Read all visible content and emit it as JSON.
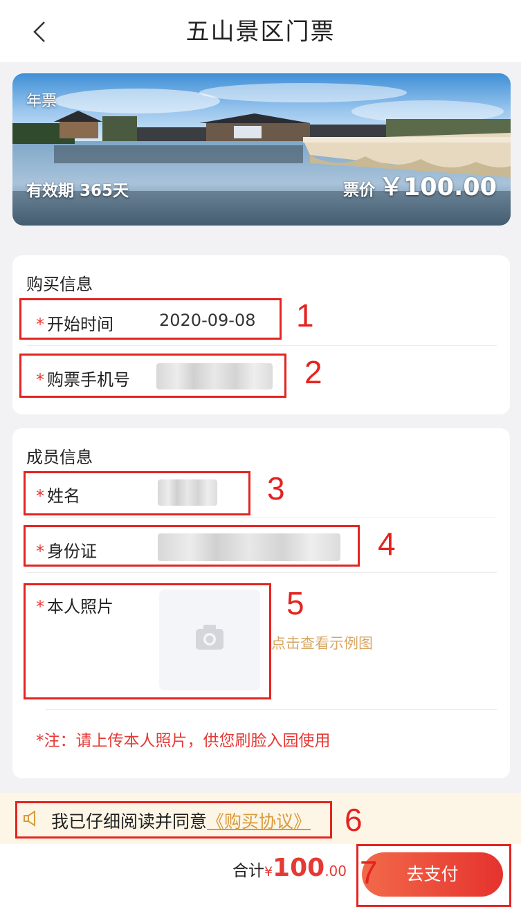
{
  "header": {
    "title": "五山景区门票"
  },
  "ticket": {
    "type_tag": "年票",
    "validity": "有效期 365天",
    "price_label": "票价",
    "price": "￥100.00"
  },
  "purchase_info": {
    "title": "购买信息",
    "start_time_label": "开始时间",
    "start_time_value": "2020-09-08",
    "phone_label": "购票手机号"
  },
  "member_info": {
    "title": "成员信息",
    "name_label": "姓名",
    "id_label": "身份证",
    "photo_label": "本人照片",
    "example_link": "点击查看示例图",
    "note": "*注：请上传本人照片，供您刷脸入园使用"
  },
  "agreement": {
    "text": "我已仔细阅读并同意",
    "link": "《购买协议》"
  },
  "footer": {
    "total_label": "合计",
    "currency": "¥",
    "total_int": "100",
    "total_dec": ".00",
    "pay_button": "去支付"
  },
  "annotations": [
    "1",
    "2",
    "3",
    "4",
    "5",
    "6",
    "7"
  ],
  "required_mark": "*",
  "colors": {
    "accent": "#e53935",
    "annotation": "#e42320",
    "link": "#d79a3c"
  }
}
